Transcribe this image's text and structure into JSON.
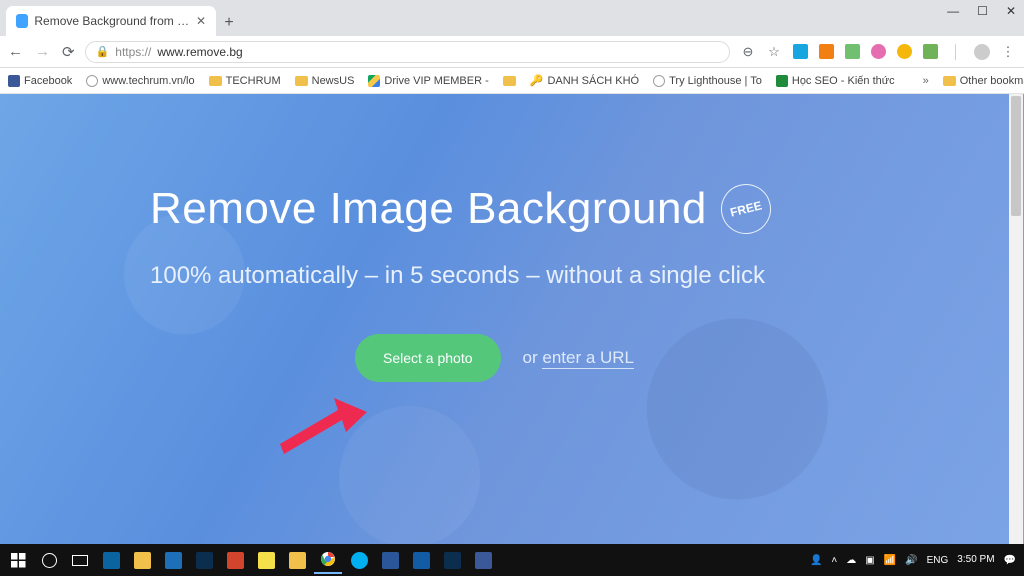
{
  "window": {
    "min": "—",
    "max": "☐",
    "close": "✕"
  },
  "tab": {
    "title": "Remove Background from Image",
    "close": "✕"
  },
  "toolbar": {
    "url_prefix": "https://",
    "url_host": "www.remove.bg"
  },
  "bookmarks": {
    "items": [
      {
        "label": "Facebook",
        "color": "#3b5998",
        "kind": "site"
      },
      {
        "label": "www.techrum.vn/lo",
        "color": "#9e9e9e",
        "kind": "globe"
      },
      {
        "label": "TECHRUM",
        "kind": "folder"
      },
      {
        "label": "NewsUS",
        "kind": "folder"
      },
      {
        "label": "Drive VIP MEMBER -",
        "color": "#13a562",
        "kind": "drive"
      },
      {
        "label": "",
        "kind": "folder"
      },
      {
        "label": "DANH SÁCH KHÓ",
        "color": "#f0c04a",
        "kind": "key"
      },
      {
        "label": "Try Lighthouse | To",
        "color": "#9e9e9e",
        "kind": "globe"
      },
      {
        "label": "Học SEO - Kiến thức",
        "color": "#1f8b3b",
        "kind": "sheet"
      }
    ],
    "overflow": "»",
    "other": "Other bookmarks"
  },
  "hero": {
    "headline": "Remove Image Background",
    "badge": "FREE",
    "subhead": "100% automatically – in 5 seconds – without a single click",
    "button": "Select a photo",
    "or": "or ",
    "link": "enter a URL"
  },
  "tray": {
    "lang": "ENG",
    "time": "3:50 PM"
  }
}
